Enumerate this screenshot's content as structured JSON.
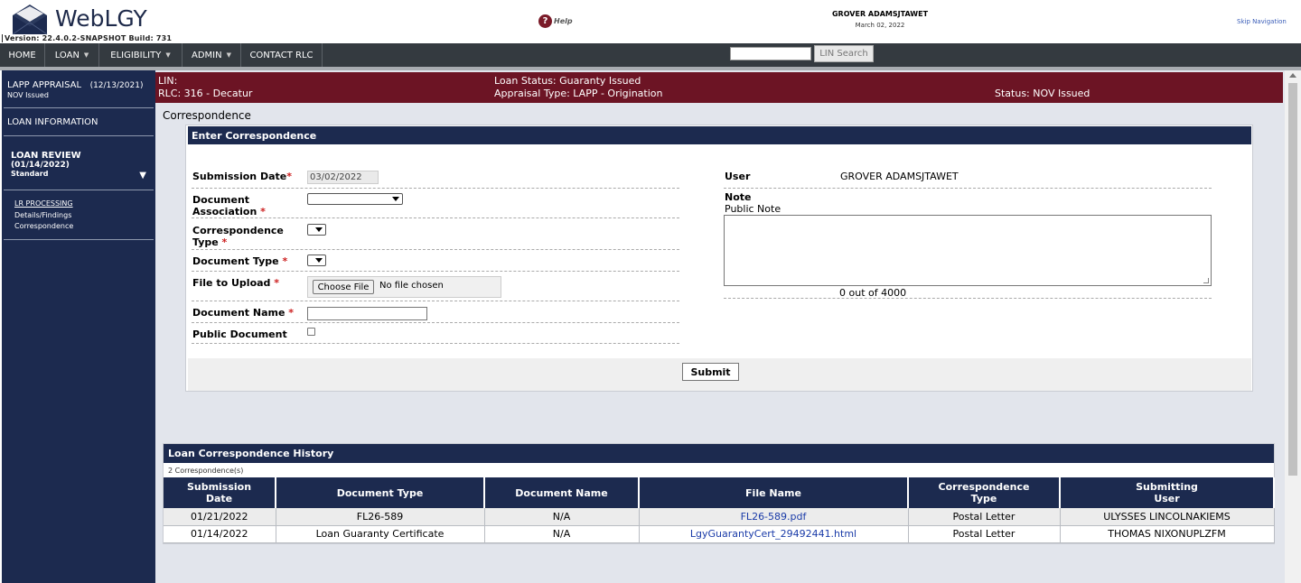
{
  "header": {
    "logo_text": "WebLGY",
    "version": "Version: 22.4.0.2-SNAPSHOT Build: 731",
    "help_label": "Help",
    "user_name": "GROVER ADAMSJTAWET",
    "date": "March 02, 2022",
    "skip_nav": "Skip Navigation"
  },
  "nav": {
    "items": [
      "HOME",
      "LOAN",
      "ELIGIBILITY",
      "ADMIN",
      "CONTACT RLC"
    ],
    "lin_search_label": "LIN Search"
  },
  "sidebar": {
    "appraisal_title": "LAPP APPRAISAL",
    "appraisal_date": "(12/13/2021)",
    "appraisal_status": "NOV Issued",
    "loan_information": "LOAN INFORMATION",
    "review_title": "LOAN REVIEW",
    "review_date": "(01/14/2022)",
    "review_type": "Standard",
    "sublinks": [
      "LR PROCESSING",
      "Details/Findings",
      "Correspondence"
    ]
  },
  "banner": {
    "lin": "LIN:",
    "rlc": "RLC: 316 - Decatur",
    "loan_status": "Loan Status: Guaranty Issued",
    "appraisal_type": "Appraisal Type: LAPP - Origination",
    "status": "Status: NOV Issued"
  },
  "section_title": "Correspondence",
  "form": {
    "header": "Enter Correspondence",
    "submission_date_label": "Submission Date",
    "submission_date_value": "03/02/2022",
    "document_association_label_1": "Document",
    "document_association_label_2": "Association",
    "correspondence_type_label_1": "Correspondence",
    "correspondence_type_label_2": "Type",
    "document_type_label": "Document Type",
    "file_upload_label": "File to Upload",
    "choose_file_label": "Choose File",
    "no_file_text": "No file chosen",
    "document_name_label": "Document Name",
    "public_document_label": "Public Document",
    "required_mark": "*",
    "user_label": "User",
    "user_value": "GROVER ADAMSJTAWET",
    "note_label": "Note",
    "public_note_label": "Public Note",
    "char_count": "0 out of 4000",
    "submit_label": "Submit"
  },
  "history": {
    "header": "Loan Correspondence History",
    "count": "2 Correspondence(s)",
    "columns": [
      [
        "Submission",
        "Date"
      ],
      [
        "Document Type",
        ""
      ],
      [
        "Document Name",
        ""
      ],
      [
        "File Name",
        ""
      ],
      [
        "Correspondence",
        "Type"
      ],
      [
        "Submitting",
        "User"
      ]
    ],
    "rows": [
      [
        "01/21/2022",
        "FL26-589",
        "N/A",
        "FL26-589.pdf",
        "Postal Letter",
        "ULYSSES LINCOLNAKIEMS"
      ],
      [
        "01/14/2022",
        "Loan Guaranty Certificate",
        "N/A",
        "LgyGuarantyCert_29492441.html",
        "Postal Letter",
        "THOMAS NIXONUPLZFM"
      ]
    ]
  },
  "colors": {
    "navy": "#1c2a4f",
    "banner": "#6c1424",
    "nav": "#343a40",
    "required": "#cc1d1d",
    "link": "#1a3ba8"
  }
}
